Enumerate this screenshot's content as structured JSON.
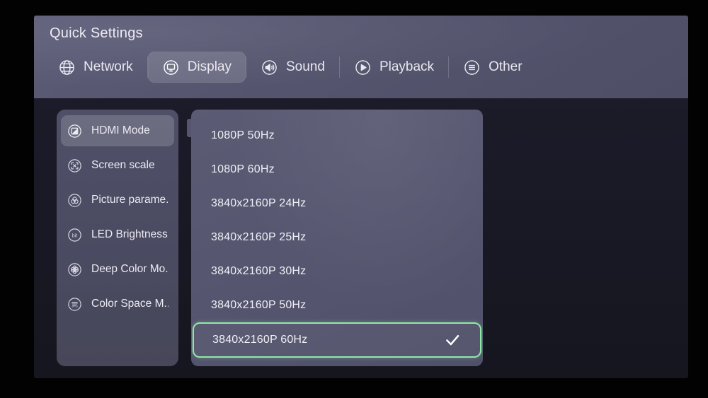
{
  "header": {
    "title": "Quick Settings"
  },
  "tabs": [
    {
      "label": "Network",
      "icon": "globe-icon",
      "selected": false
    },
    {
      "label": "Display",
      "icon": "monitor-icon",
      "selected": true
    },
    {
      "label": "Sound",
      "icon": "speaker-icon",
      "selected": false
    },
    {
      "label": "Playback",
      "icon": "play-icon",
      "selected": false
    },
    {
      "label": "Other",
      "icon": "hamburger-icon",
      "selected": false
    }
  ],
  "sidebar": {
    "items": [
      {
        "label": "HDMI Mode",
        "icon": "hdmi-mode-icon",
        "selected": true
      },
      {
        "label": "Screen scale",
        "icon": "screen-scale-icon",
        "selected": false
      },
      {
        "label": "Picture parame..",
        "icon": "picture-params-icon",
        "selected": false
      },
      {
        "label": "LED Brightness",
        "icon": "bit-depth-icon",
        "selected": false
      },
      {
        "label": "Deep Color Mo..",
        "icon": "deep-color-icon",
        "selected": false
      },
      {
        "label": "Color Space M..",
        "icon": "color-space-icon",
        "selected": false
      }
    ]
  },
  "content": {
    "modes": [
      {
        "label": "1080P  50Hz",
        "selected": false
      },
      {
        "label": "1080P  60Hz",
        "selected": false
      },
      {
        "label": "3840x2160P  24Hz",
        "selected": false
      },
      {
        "label": "3840x2160P  25Hz",
        "selected": false
      },
      {
        "label": "3840x2160P  30Hz",
        "selected": false
      },
      {
        "label": "3840x2160P  50Hz",
        "selected": false
      },
      {
        "label": "3840x2160P  60Hz",
        "selected": true
      }
    ],
    "selected_mode": "3840x2160P  60Hz",
    "check_icon": "check-icon"
  },
  "colors": {
    "highlight_green": "#8fe9a6",
    "panel": "#56566f",
    "header": "#55556f",
    "text": "#eceaf2",
    "backdrop": "#000000"
  }
}
